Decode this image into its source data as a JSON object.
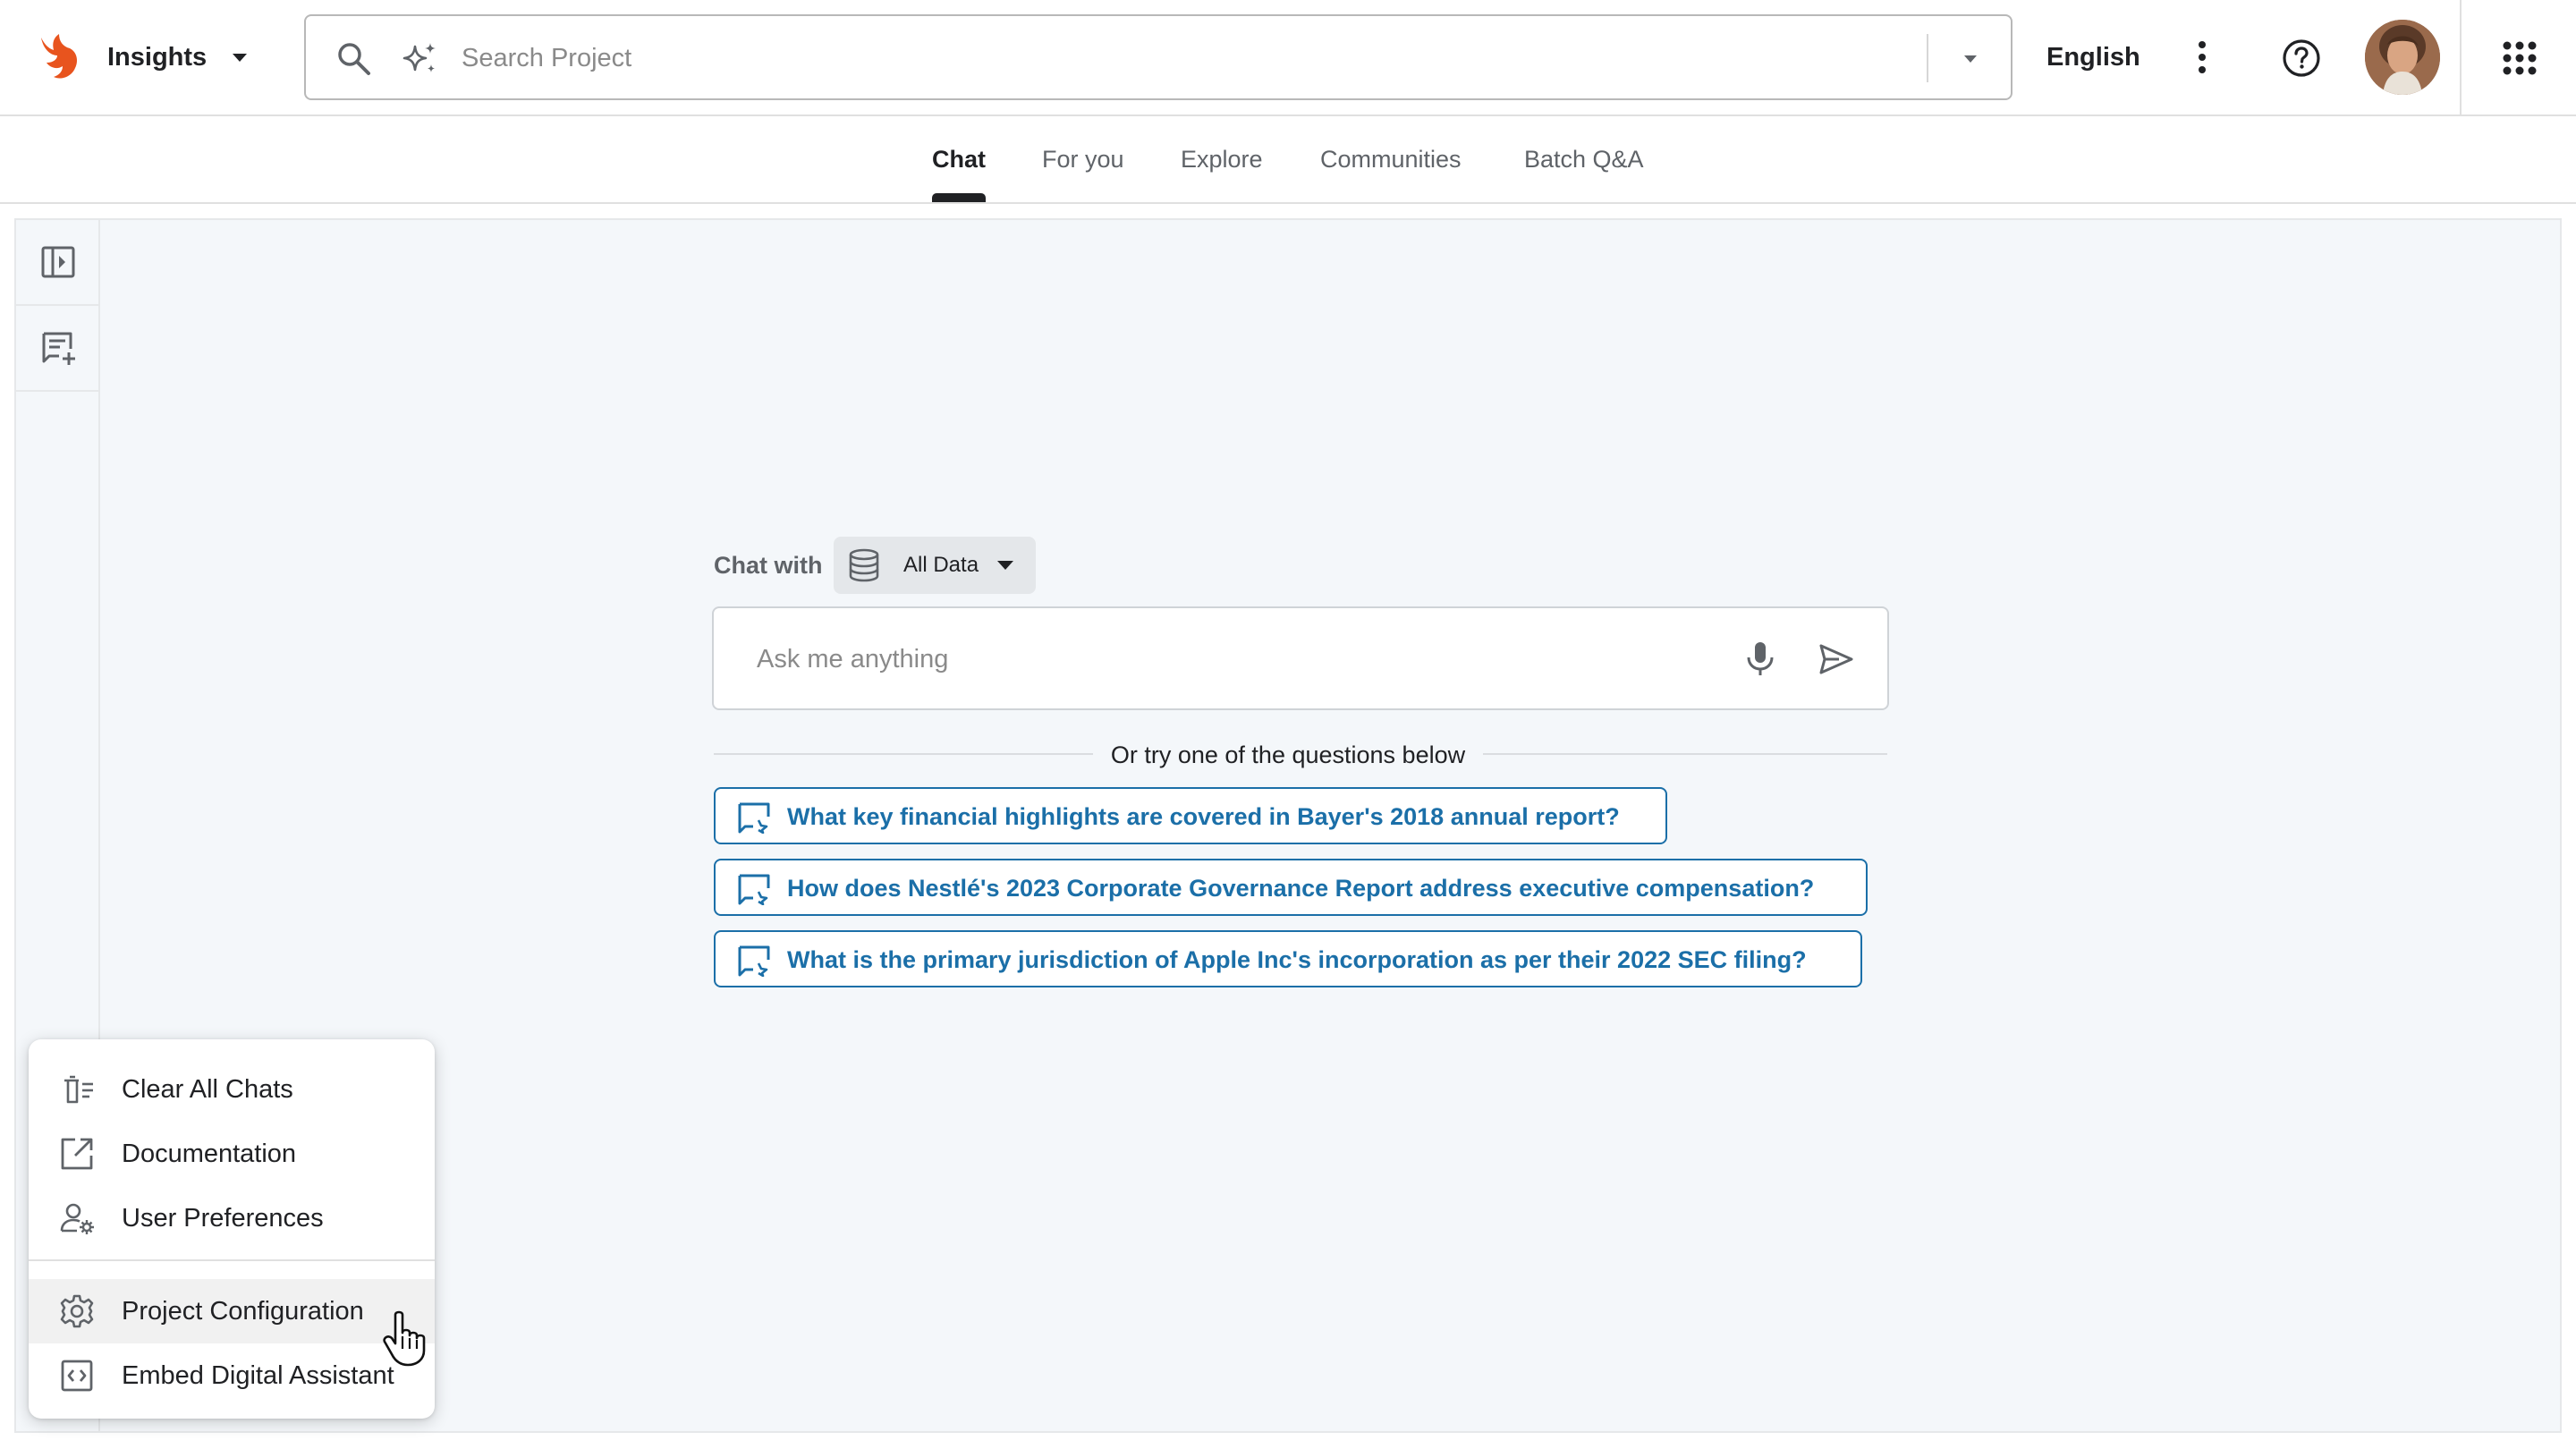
{
  "header": {
    "app_name": "Insights",
    "search_placeholder": "Search Project",
    "language": "English",
    "icons": [
      "logo-icon",
      "chevron-down-icon",
      "search-icon",
      "sparkle-icon",
      "more-vert-icon",
      "help-icon",
      "apps-grid-icon"
    ]
  },
  "tabs": [
    {
      "label": "Chat",
      "active": true
    },
    {
      "label": "For you",
      "active": false
    },
    {
      "label": "Explore",
      "active": false
    },
    {
      "label": "Communities",
      "active": false
    },
    {
      "label": "Batch Q&A",
      "active": false
    }
  ],
  "chat": {
    "chat_with_label": "Chat with",
    "data_source": "All Data",
    "input_placeholder": "Ask me anything",
    "try_text": "Or try one of the questions below",
    "questions": [
      "What key financial highlights are covered in Bayer's 2018 annual report?",
      "How does Nestlé's 2023 Corporate Governance Report address executive compensation?",
      "What is the primary jurisdiction of Apple Inc's incorporation as per their 2022 SEC filing?"
    ]
  },
  "menu": {
    "items": [
      {
        "label": "Clear All Chats",
        "icon": "clear-list-icon"
      },
      {
        "label": "Documentation",
        "icon": "external-link-icon"
      },
      {
        "label": "User Preferences",
        "icon": "user-settings-icon"
      },
      {
        "label": "Project Configuration",
        "icon": "gear-icon"
      },
      {
        "label": "Embed Digital Assistant",
        "icon": "code-embed-icon"
      }
    ]
  },
  "colors": {
    "accent": "#1b6fa8",
    "logo": "#e8541e",
    "panel_bg": "#f4f7fa"
  }
}
